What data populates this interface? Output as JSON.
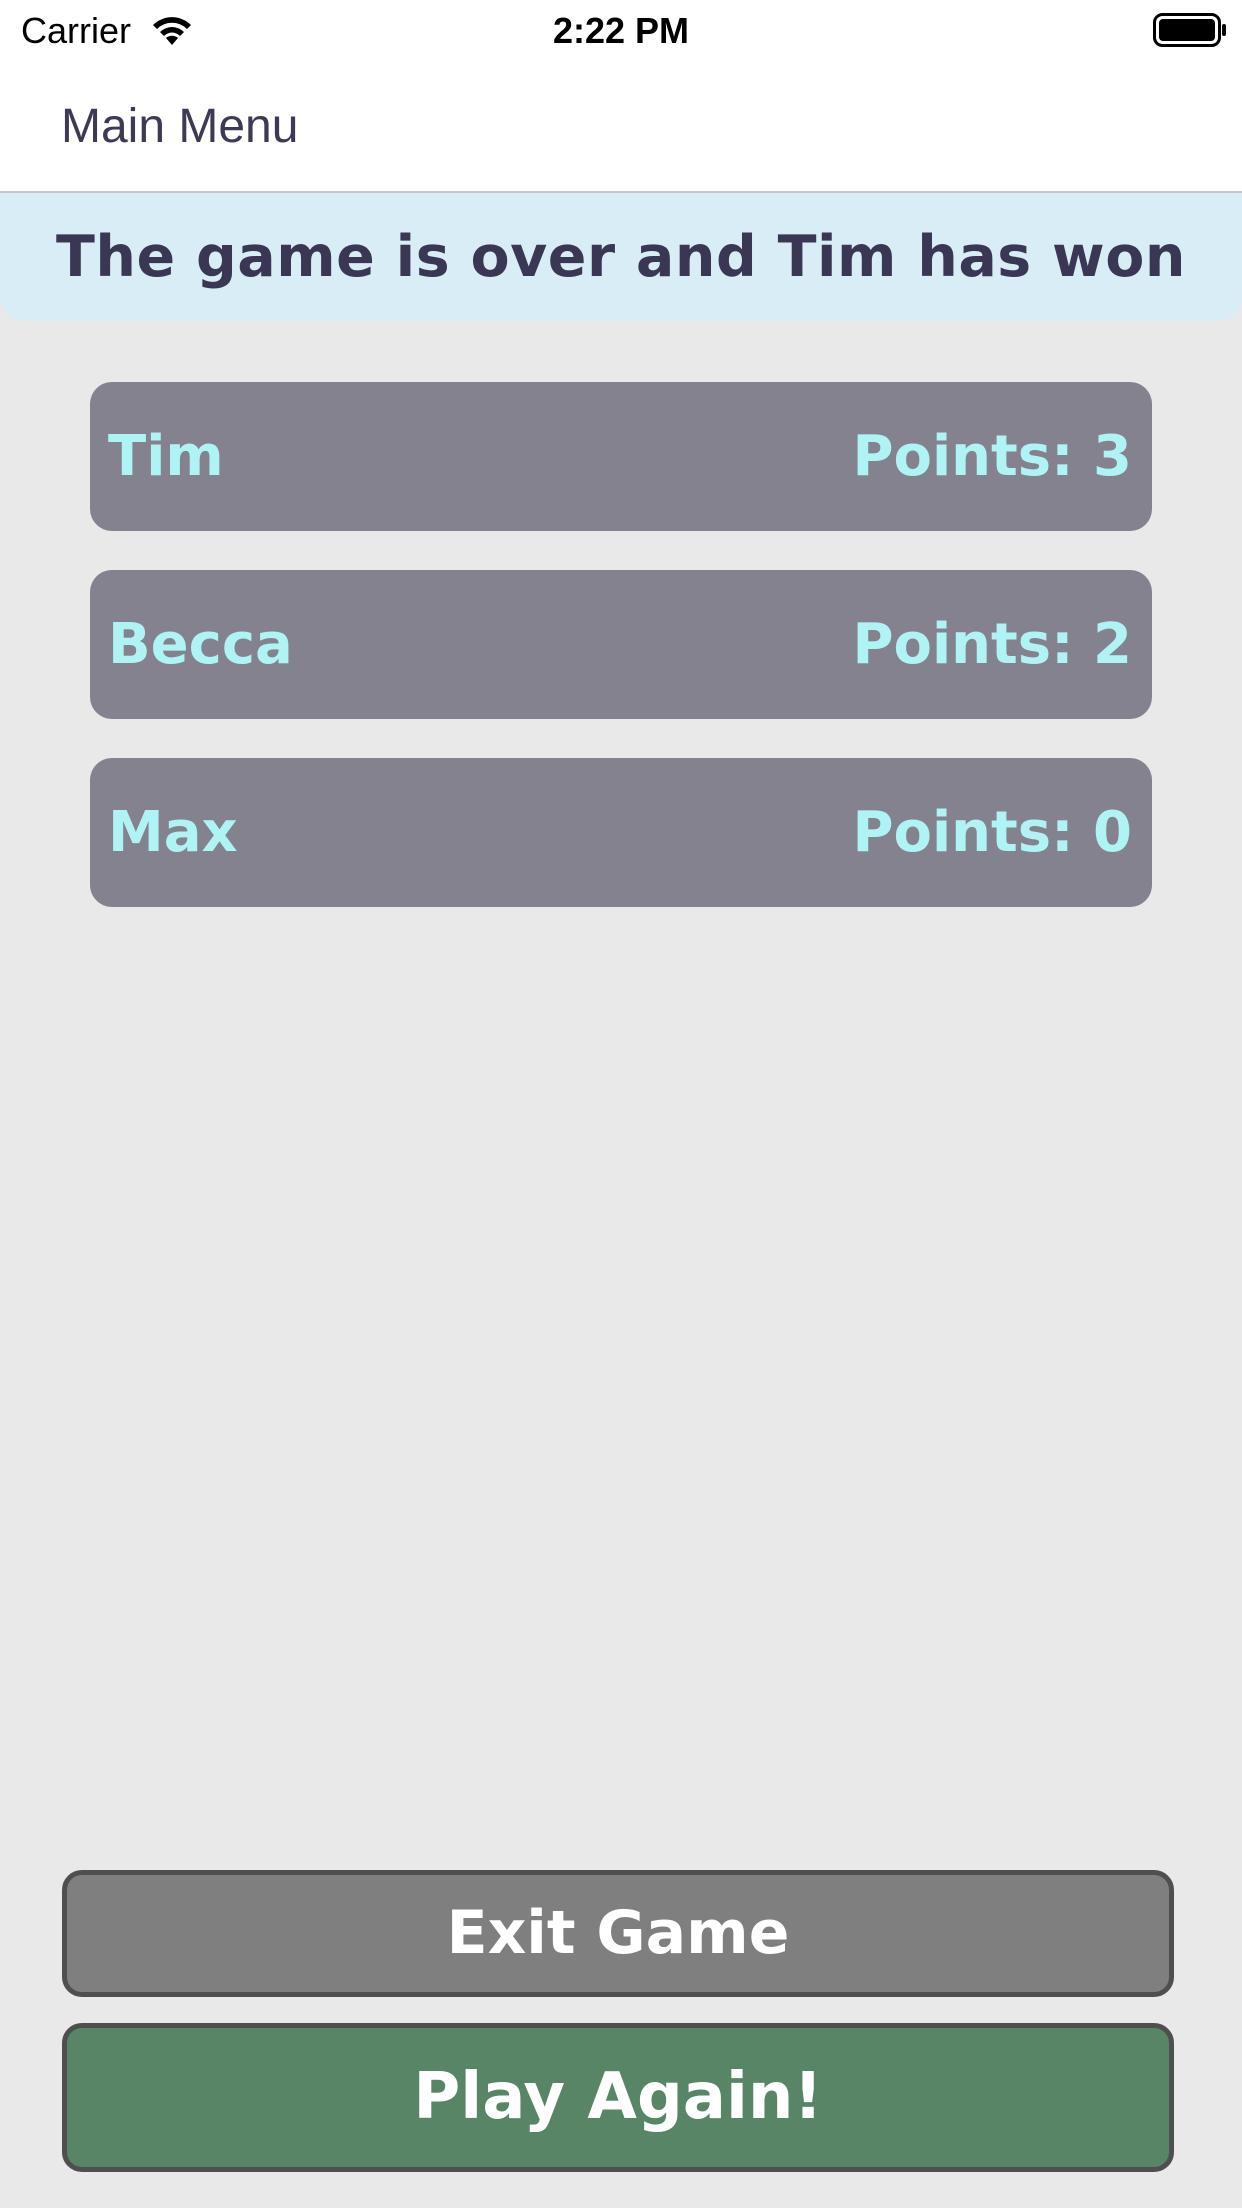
{
  "status_bar": {
    "carrier": "Carrier",
    "time": "2:22 PM"
  },
  "nav": {
    "back_label": "Main Menu"
  },
  "banner": {
    "text": "The game is over and Tim has won"
  },
  "players": [
    {
      "name": "Tim",
      "points": "Points: 3"
    },
    {
      "name": "Becca",
      "points": "Points: 2"
    },
    {
      "name": "Max",
      "points": "Points: 0"
    }
  ],
  "actions": {
    "exit_label": "Exit Game",
    "play_again_label": "Play Again!"
  },
  "colors": {
    "background": "#e9e9ea",
    "banner": "#d8edf5",
    "card": "#84828f",
    "card_text": "#b0f3f4",
    "exit_button": "#7f7f7f",
    "play_button": "#588566"
  },
  "icons": [
    "wifi-icon",
    "battery-icon"
  ]
}
